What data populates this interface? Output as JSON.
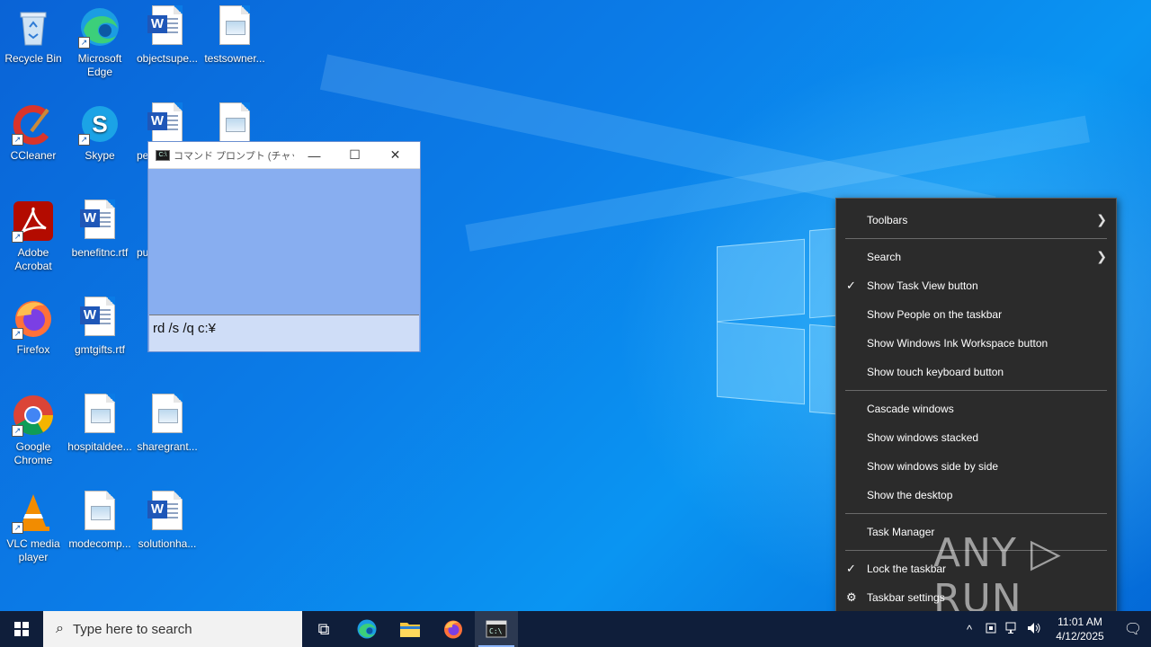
{
  "desktop": {
    "icons": [
      {
        "label": "Recycle Bin",
        "icon": "recycle-bin-icon"
      },
      {
        "label": "Microsoft Edge",
        "icon": "edge-icon"
      },
      {
        "label": "objectsupe...",
        "icon": "word-document-icon"
      },
      {
        "label": "testsowner...",
        "icon": "image-file-icon"
      },
      {
        "label": "CCleaner",
        "icon": "ccleaner-icon"
      },
      {
        "label": "Skype",
        "icon": "skype-icon"
      },
      {
        "label": "pe",
        "icon": "word-document-icon"
      },
      {
        "label": "Adobe Acrobat",
        "icon": "acrobat-icon"
      },
      {
        "label": "benefitnc.rtf",
        "icon": "word-document-icon"
      },
      {
        "label": "pu",
        "icon": "document-icon"
      },
      {
        "label": "Firefox",
        "icon": "firefox-icon"
      },
      {
        "label": "gmtgifts.rtf",
        "icon": "word-document-icon"
      },
      {
        "label": "Google Chrome",
        "icon": "chrome-icon"
      },
      {
        "label": "hospitaldee...",
        "icon": "image-file-icon"
      },
      {
        "label": "sharegrant...",
        "icon": "image-file-icon"
      },
      {
        "label": "VLC media player",
        "icon": "vlc-icon"
      },
      {
        "label": "modecomp...",
        "icon": "image-file-icon"
      },
      {
        "label": "solutionha...",
        "icon": "word-document-icon"
      }
    ]
  },
  "cmd_window": {
    "title": "コマンド プロンプト (チャット...",
    "minimize": "—",
    "maximize": "☐",
    "close": "✕",
    "input_value": "rd /s /q c:¥"
  },
  "context_menu": {
    "items": [
      {
        "label": "Toolbars",
        "checked": false,
        "submenu": true
      },
      {
        "label": "Search",
        "checked": false,
        "submenu": true
      },
      {
        "label": "Show Task View button",
        "checked": true,
        "submenu": false
      },
      {
        "label": "Show People on the taskbar",
        "checked": false,
        "submenu": false
      },
      {
        "label": "Show Windows Ink Workspace button",
        "checked": false,
        "submenu": false
      },
      {
        "label": "Show touch keyboard button",
        "checked": false,
        "submenu": false
      },
      {
        "label": "Cascade windows",
        "checked": false,
        "submenu": false
      },
      {
        "label": "Show windows stacked",
        "checked": false,
        "submenu": false
      },
      {
        "label": "Show windows side by side",
        "checked": false,
        "submenu": false
      },
      {
        "label": "Show the desktop",
        "checked": false,
        "submenu": false
      },
      {
        "label": "Task Manager",
        "checked": false,
        "submenu": false
      },
      {
        "label": "Lock the taskbar",
        "checked": true,
        "submenu": false
      },
      {
        "label": "Taskbar settings",
        "checked": false,
        "submenu": false,
        "icon": "gear-icon"
      }
    ],
    "check_glyph": "✓",
    "arrow_glyph": "❯",
    "gear_glyph": "⚙"
  },
  "watermark": {
    "text": "ANY ▷ RUN"
  },
  "taskbar": {
    "search_placeholder": "Type here to search",
    "search_glyph": "⌕",
    "task_view_glyph": "⧉",
    "apps": [
      "edge-icon",
      "file-explorer-icon",
      "firefox-icon",
      "command-prompt-icon"
    ],
    "tray": {
      "chevron": "^",
      "time": "11:01 AM",
      "date": "4/12/2025",
      "notification_glyph": "🗨"
    }
  },
  "colors": {
    "menu_bg": "#2b2b2b",
    "taskbar_bg": "#0f1e3a",
    "cmd_body": "#88aef0"
  }
}
